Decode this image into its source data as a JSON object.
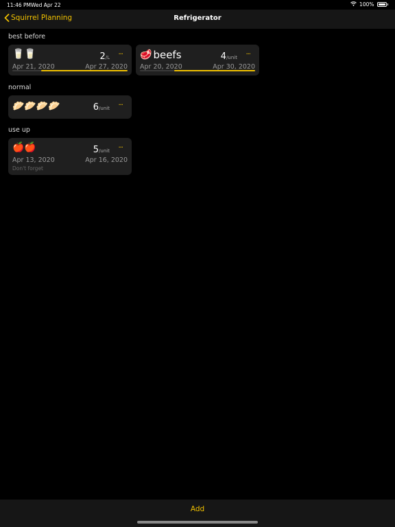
{
  "status": {
    "time": "11:46 PM",
    "date": "Wed Apr 22",
    "battery": "100%"
  },
  "nav": {
    "back_label": "Squirrel Planning",
    "title": "Refrigerator"
  },
  "sections": {
    "best_before": {
      "label": "best before",
      "items": [
        {
          "emoji": "🥛🥛",
          "name": "",
          "quantity": "2",
          "unit": "/L",
          "start_date": "Apr 21, 2020",
          "end_date": "Apr 27, 2020",
          "progress": 0.75
        },
        {
          "emoji": "🥩",
          "name": "beefs",
          "quantity": "4",
          "unit": "/unit",
          "start_date": "Apr 20, 2020",
          "end_date": "Apr 30, 2020",
          "progress": 0.7
        }
      ]
    },
    "normal": {
      "label": "normal",
      "items": [
        {
          "emoji": "🥟🥟🥟🥟",
          "quantity": "6",
          "unit": "/unit"
        }
      ]
    },
    "use_up": {
      "label": "use up",
      "items": [
        {
          "emoji": "🍎🍎",
          "quantity": "5",
          "unit": "/unit",
          "start_date": "Apr 13, 2020",
          "end_date": "Apr 16, 2020",
          "note": "Don't forget"
        }
      ]
    }
  },
  "more_label": "···",
  "toolbar": {
    "add_label": "Add"
  },
  "colors": {
    "accent": "#f0c000",
    "background": "#000000",
    "card": "#1f1f1f",
    "bar": "#161616"
  },
  "icons": {
    "back": "chevron-left-icon",
    "wifi": "wifi-icon",
    "battery": "battery-icon"
  }
}
